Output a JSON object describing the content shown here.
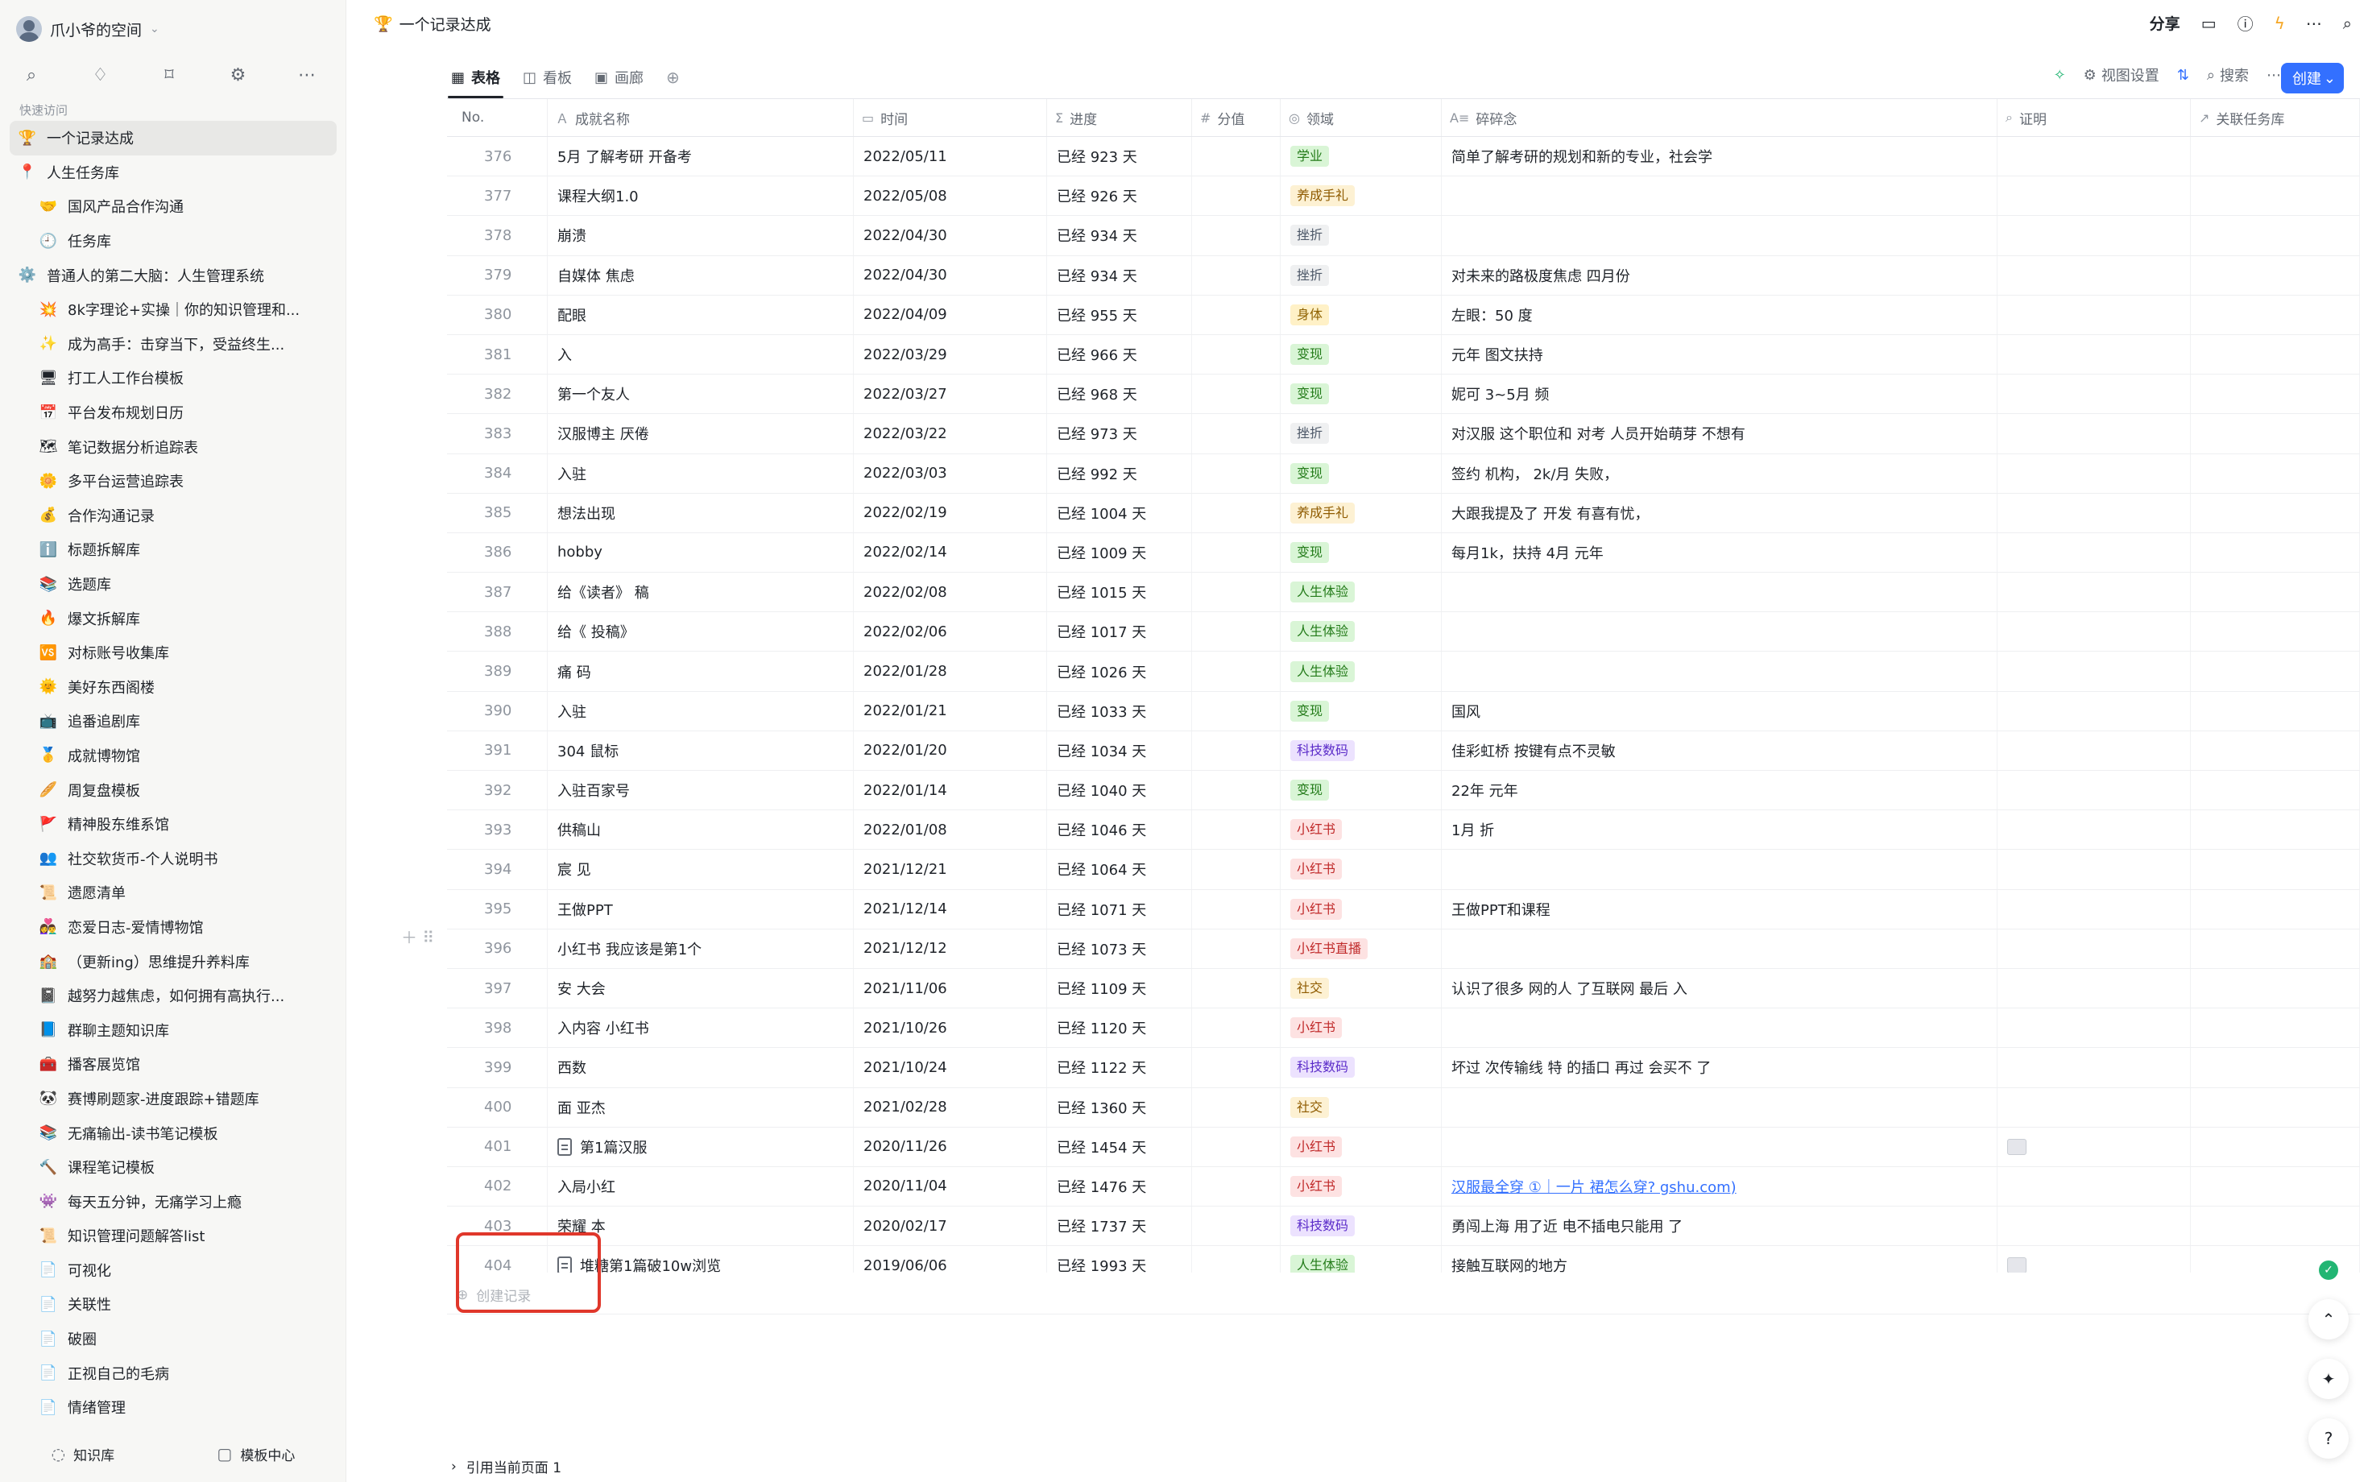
{
  "workspace": {
    "name": "爪小爷的空间"
  },
  "sidebar": {
    "quick_label": "快速访问",
    "items": [
      {
        "label": "一个记录达成",
        "icon": "🏆",
        "level": 0,
        "active": true
      },
      {
        "label": "人生任务库",
        "icon": "📍",
        "level": 0
      },
      {
        "label": "国风产品合作沟通",
        "icon": "🤝",
        "level": 1
      },
      {
        "label": "任务库",
        "icon": "🕘",
        "level": 1
      },
      {
        "label": "普通人的第二大脑：人生管理系统",
        "icon": "⚙️",
        "level": 0
      },
      {
        "label": "8k字理论+实操｜你的知识管理和...",
        "icon": "💥",
        "level": 1
      },
      {
        "label": "成为高手：击穿当下，受益终生...",
        "icon": "✨",
        "level": 1
      },
      {
        "label": "打工人工作台模板",
        "icon": "🖥",
        "level": 1
      },
      {
        "label": "平台发布规划日历",
        "icon": "📅",
        "level": 1
      },
      {
        "label": "笔记数据分析追踪表",
        "icon": "🗺",
        "level": 1
      },
      {
        "label": "多平台运营追踪表",
        "icon": "🌼",
        "level": 1
      },
      {
        "label": "合作沟通记录",
        "icon": "💰",
        "level": 1
      },
      {
        "label": "标题拆解库",
        "icon": "ℹ️",
        "level": 1
      },
      {
        "label": "选题库",
        "icon": "📚",
        "level": 1
      },
      {
        "label": "爆文拆解库",
        "icon": "🔥",
        "level": 1
      },
      {
        "label": "对标账号收集库",
        "icon": "🆚",
        "level": 1
      },
      {
        "label": "美好东西阁楼",
        "icon": "🌞",
        "level": 1
      },
      {
        "label": "追番追剧库",
        "icon": "📺",
        "level": 1
      },
      {
        "label": "成就博物馆",
        "icon": "🥇",
        "level": 1
      },
      {
        "label": "周复盘模板",
        "icon": "🥖",
        "level": 1
      },
      {
        "label": "精神股东维系馆",
        "icon": "🚩",
        "level": 1
      },
      {
        "label": "社交软货币-个人说明书",
        "icon": "👥",
        "level": 1
      },
      {
        "label": "遗愿清单",
        "icon": "📜",
        "level": 1
      },
      {
        "label": "恋爱日志-爱情博物馆",
        "icon": "👩‍❤️‍👨",
        "level": 1
      },
      {
        "label": "（更新ing）思维提升养料库",
        "icon": "🏫",
        "level": 1
      },
      {
        "label": "越努力越焦虑，如何拥有高执行...",
        "icon": "📓",
        "level": 1
      },
      {
        "label": "群聊主题知识库",
        "icon": "📘",
        "level": 1
      },
      {
        "label": "播客展览馆",
        "icon": "🧰",
        "level": 1
      },
      {
        "label": "赛博刷题家-进度跟踪+错题库",
        "icon": "🐼",
        "level": 1
      },
      {
        "label": "无痛输出-读书笔记模板",
        "icon": "📚",
        "level": 1
      },
      {
        "label": "课程笔记模板",
        "icon": "🔨",
        "level": 1
      },
      {
        "label": "每天五分钟，无痛学习上瘾",
        "icon": "👾",
        "level": 1
      },
      {
        "label": "知识管理问题解答list",
        "icon": "📜",
        "level": 1
      },
      {
        "label": "可视化",
        "icon": "📄",
        "level": 1
      },
      {
        "label": "关联性",
        "icon": "📄",
        "level": 1
      },
      {
        "label": "破圈",
        "icon": "📄",
        "level": 1
      },
      {
        "label": "正视自己的毛病",
        "icon": "📄",
        "level": 1
      },
      {
        "label": "情绪管理",
        "icon": "📄",
        "level": 1
      }
    ],
    "bottom": {
      "kb": "知识库",
      "templates": "模板中心"
    }
  },
  "header": {
    "title": "一个记录达成",
    "title_icon": "🏆",
    "share": "分享"
  },
  "views": [
    {
      "label": "表格",
      "icon": "▦",
      "active": true
    },
    {
      "label": "看板",
      "icon": "◫"
    },
    {
      "label": "画廊",
      "icon": "▣"
    }
  ],
  "tools": {
    "view_settings": "视图设置",
    "search": "搜索",
    "create": "创建"
  },
  "columns": [
    {
      "label": "No.",
      "icon": ""
    },
    {
      "label": "成就名称",
      "icon": "Ａ"
    },
    {
      "label": "时间",
      "icon": "▭"
    },
    {
      "label": "进度",
      "icon": "Σ"
    },
    {
      "label": "分值",
      "icon": "#"
    },
    {
      "label": "领域",
      "icon": "◎"
    },
    {
      "label": "碎碎念",
      "icon": "A≡"
    },
    {
      "label": "证明",
      "icon": "⌕"
    },
    {
      "label": "关联任务库",
      "icon": "↗"
    }
  ],
  "rows": [
    {
      "no": "376",
      "name": "5月 了解考研 开备考",
      "time": "2022/05/11",
      "progress": "已经 923 天",
      "area": "学业",
      "note": "简单了解考研的规划和新的专业，社会学"
    },
    {
      "no": "377",
      "name": "课程大纲1.0",
      "time": "2022/05/08",
      "progress": "已经 926 天",
      "area": "养成手礼",
      "note": ""
    },
    {
      "no": "378",
      "name": "崩溃",
      "time": "2022/04/30",
      "progress": "已经 934 天",
      "area": "挫折",
      "note": ""
    },
    {
      "no": "379",
      "name": "自媒体 焦虑",
      "time": "2022/04/30",
      "progress": "已经 934 天",
      "area": "挫折",
      "note": "对未来的路极度焦虑 四月份"
    },
    {
      "no": "380",
      "name": "配眼",
      "time": "2022/04/09",
      "progress": "已经 955 天",
      "area": "身体",
      "note": "左眼：50 度"
    },
    {
      "no": "381",
      "name": "入 ",
      "time": "2022/03/29",
      "progress": "已经 966 天",
      "area": "变现",
      "note": "元年 图文扶持"
    },
    {
      "no": "382",
      "name": "第一个友人",
      "time": "2022/03/27",
      "progress": "已经 968 天",
      "area": "变现",
      "note": "妮可 3~5月 频"
    },
    {
      "no": "383",
      "name": "汉服博主 厌倦",
      "time": "2022/03/22",
      "progress": "已经 973 天",
      "area": "挫折",
      "note": "对汉服 这个职位和 对考 人员开始萌芽 不想有"
    },
    {
      "no": "384",
      "name": "入驻 ",
      "time": "2022/03/03",
      "progress": "已经 992 天",
      "area": "变现",
      "note": "签约 机构， 2k/月 失败，"
    },
    {
      "no": "385",
      "name": "想法出现",
      "time": "2022/02/19",
      "progress": "已经 1004 天",
      "area": "养成手礼",
      "note": "大跟我提及了 开发 有喜有忧，"
    },
    {
      "no": "386",
      "name": "hobby",
      "time": "2022/02/14",
      "progress": "已经 1009 天",
      "area": "变现",
      "note": "每月1k，扶持 4月 元年"
    },
    {
      "no": "387",
      "name": "给《读者》 稿",
      "time": "2022/02/08",
      "progress": "已经 1015 天",
      "area": "人生体验",
      "note": ""
    },
    {
      "no": "388",
      "name": "给《 投稿》",
      "time": "2022/02/06",
      "progress": "已经 1017 天",
      "area": "人生体验",
      "note": ""
    },
    {
      "no": "389",
      "name": "痛 码",
      "time": "2022/01/28",
      "progress": "已经 1026 天",
      "area": "人生体验",
      "note": ""
    },
    {
      "no": "390",
      "name": " 入驻",
      "time": "2022/01/21",
      "progress": "已经 1033 天",
      "area": "变现",
      "note": "国风"
    },
    {
      "no": "391",
      "name": "304 鼠标",
      "time": "2022/01/20",
      "progress": "已经 1034 天",
      "area": "科技数码",
      "note": "佳彩虹桥 按键有点不灵敏"
    },
    {
      "no": "392",
      "name": "入驻百家号",
      "time": "2022/01/14",
      "progress": "已经 1040 天",
      "area": "变现",
      "note": "22年 元年"
    },
    {
      "no": "393",
      "name": "供稿山",
      "time": "2022/01/08",
      "progress": "已经 1046 天",
      "area": "小红书",
      "note": "1月 折"
    },
    {
      "no": "394",
      "name": "宸 见",
      "time": "2021/12/21",
      "progress": "已经 1064 天",
      "area": "小红书",
      "note": ""
    },
    {
      "no": "395",
      "name": "王做PPT",
      "time": "2021/12/14",
      "progress": "已经 1071 天",
      "area": "小红书",
      "note": "王做PPT和课程"
    },
    {
      "no": "396",
      "name": "小红书 我应该是第1个",
      "time": "2021/12/12",
      "progress": "已经 1073 天",
      "area": "小红书直播",
      "note": ""
    },
    {
      "no": "397",
      "name": "安 大会",
      "time": "2021/11/06",
      "progress": "已经 1109 天",
      "area": "社交",
      "note": "认识了很多 网的人 了互联网 最后 入"
    },
    {
      "no": "398",
      "name": "入内容 小红书",
      "time": "2021/10/26",
      "progress": "已经 1120 天",
      "area": "小红书",
      "note": ""
    },
    {
      "no": "399",
      "name": "西数",
      "time": "2021/10/24",
      "progress": "已经 1122 天",
      "area": "科技数码",
      "note": "坏过 次传输线 特 的插口 再过 会买不 了"
    },
    {
      "no": "400",
      "name": "面 亚杰",
      "time": "2021/02/28",
      "progress": "已经 1360 天",
      "area": "社交",
      "note": ""
    },
    {
      "no": "401",
      "name": "第1篇汉服",
      "time": "2020/11/26",
      "progress": "已经 1454 天",
      "area": "小红书",
      "note": "",
      "doc": true,
      "thumb": true
    },
    {
      "no": "402",
      "name": "入局小红",
      "time": "2020/11/04",
      "progress": "已经 1476 天",
      "area": "小红书",
      "note": "汉服最全穿 ①｜一片 裙怎么穿? gshu.com)",
      "link": true
    },
    {
      "no": "403",
      "name": "荣耀 本",
      "time": "2020/02/17",
      "progress": "已经 1737 天",
      "area": "科技数码",
      "note": "勇闯上海 用了近 电不插电只能用 了"
    },
    {
      "no": "404",
      "name": "堆糖第1篇破10w浏览",
      "time": "2019/06/06",
      "progress": "已经 1993 天",
      "area": "人生体验",
      "note": "接触互联网的地方",
      "doc": true,
      "thumb": true
    }
  ],
  "tag_colors": {
    "学业": {
      "bg": "#d9f5d6",
      "fg": "#237b19"
    },
    "养成手礼": {
      "bg": "#fdf1d3",
      "fg": "#8f5b00"
    },
    "挫折": {
      "bg": "#eff0f1",
      "fg": "#4e5969"
    },
    "身体": {
      "bg": "#fff1c7",
      "fg": "#8f6200"
    },
    "变现": {
      "bg": "#d9f5d6",
      "fg": "#237b19"
    },
    "人生体验": {
      "bg": "#d9f5d6",
      "fg": "#237b19"
    },
    "科技数码": {
      "bg": "#ece2fe",
      "fg": "#5b2cc9"
    },
    "小红书": {
      "bg": "#fde2e2",
      "fg": "#c02a2a"
    },
    "小红书直播": {
      "bg": "#fde2e2",
      "fg": "#c02a2a"
    },
    "社交": {
      "bg": "#fdf1d3",
      "fg": "#8f5b00"
    }
  },
  "create_record": "创建记录",
  "footer": {
    "ref": "引用当前页面 1"
  }
}
